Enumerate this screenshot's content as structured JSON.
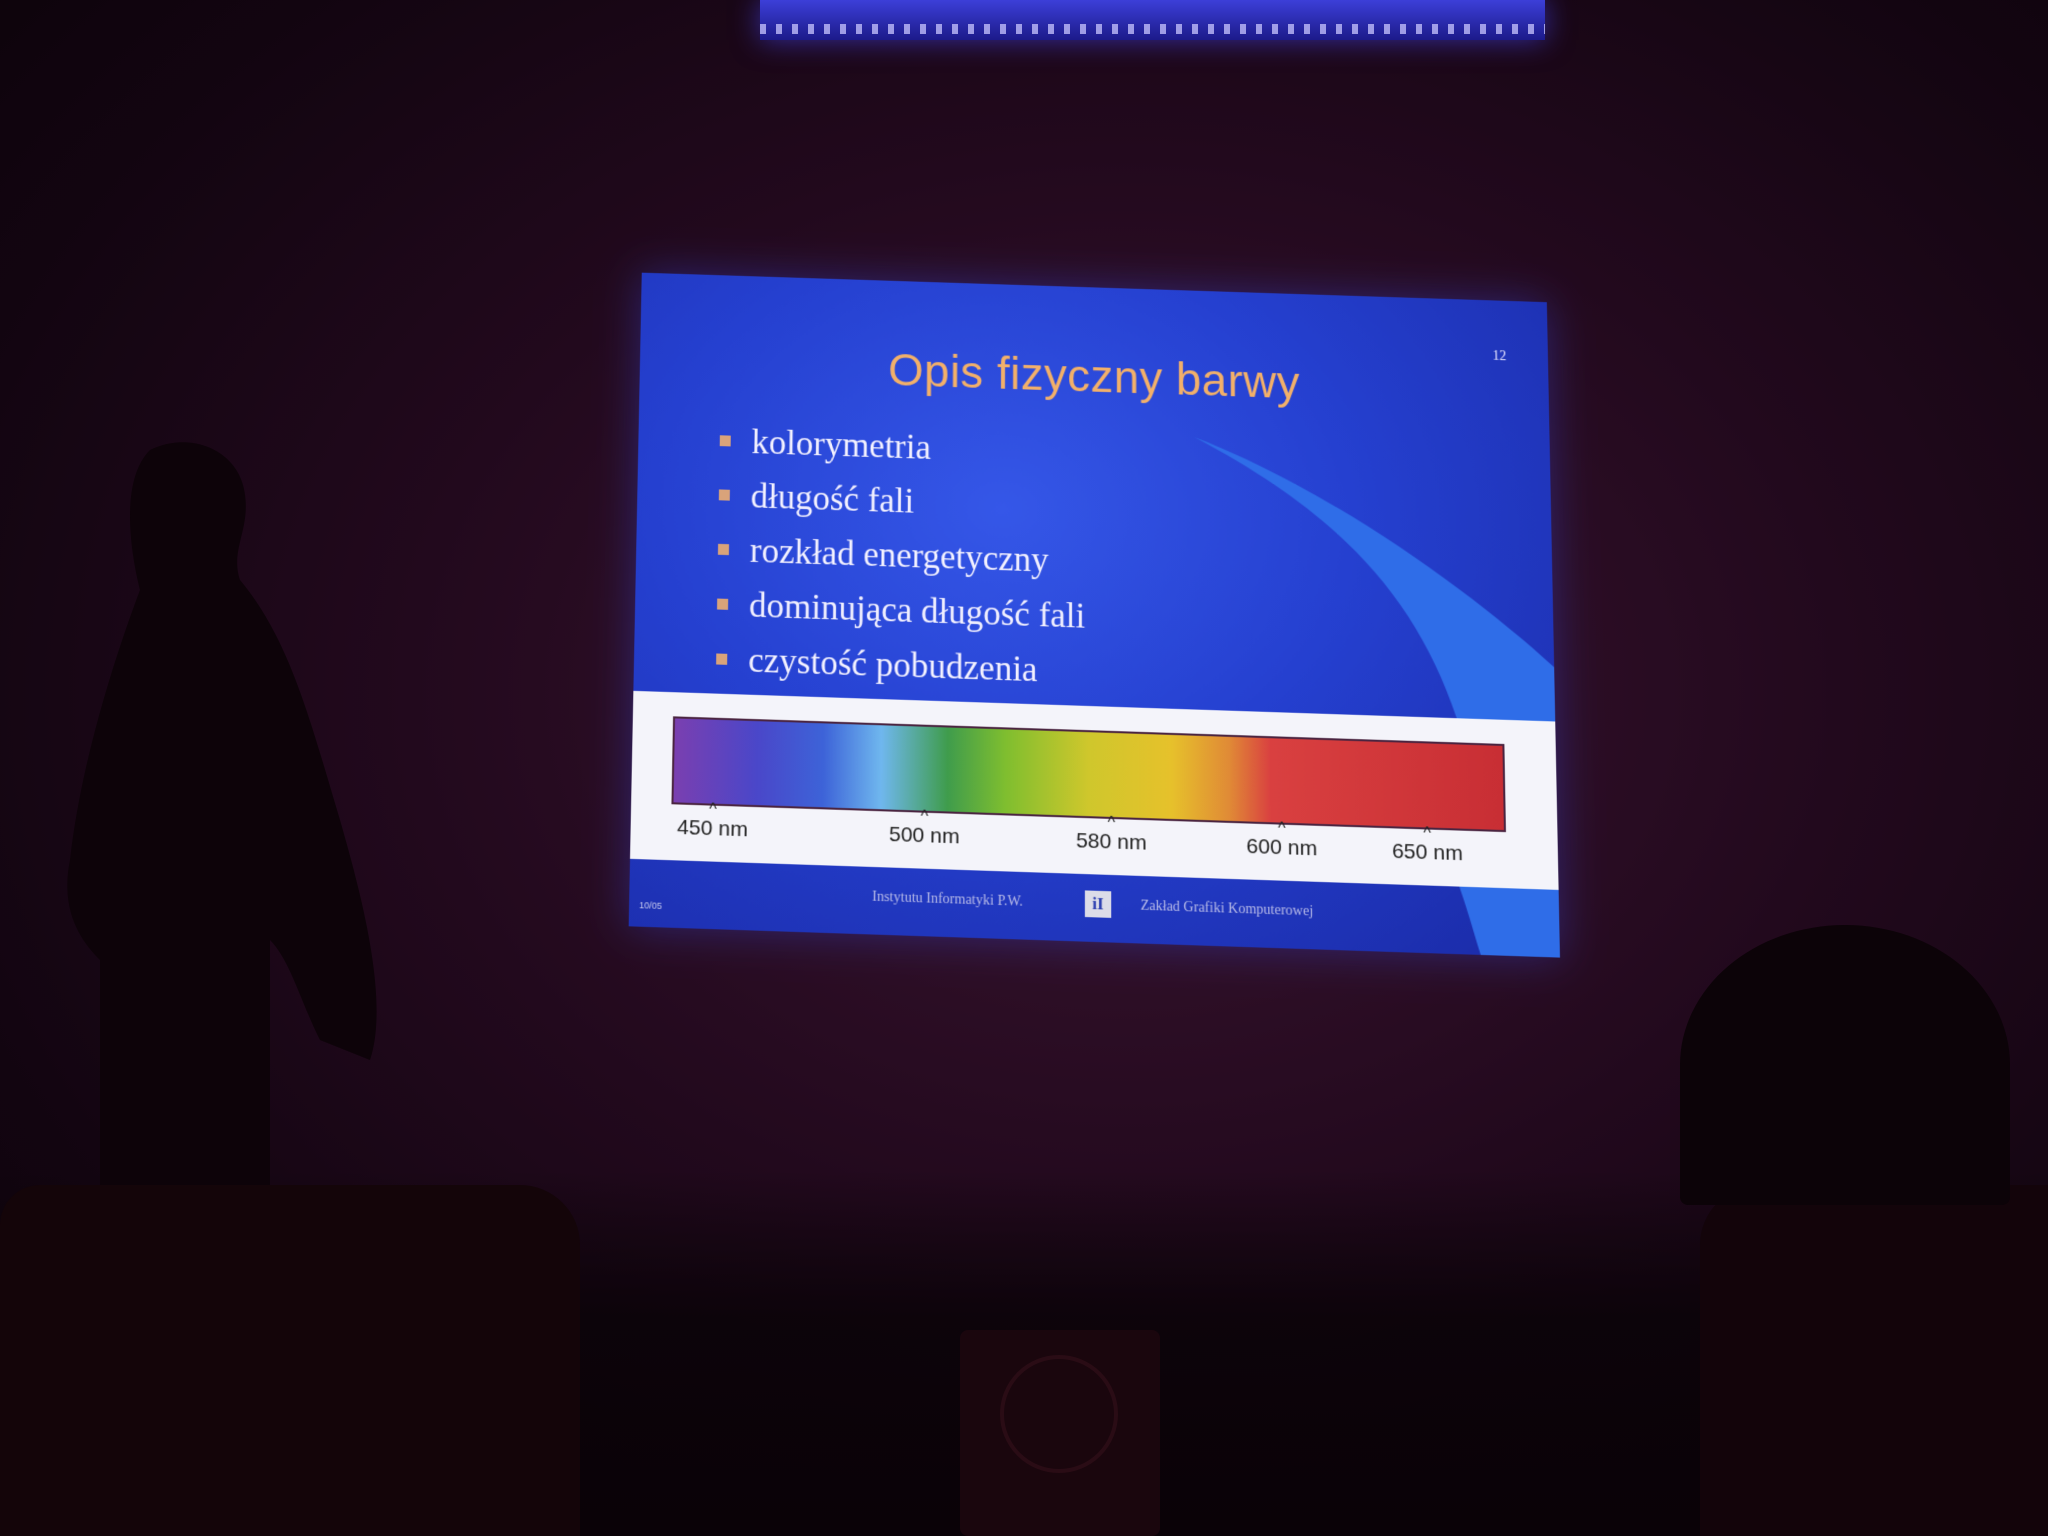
{
  "slide": {
    "number": "12",
    "title": "Opis fizyczny barwy",
    "bullets": [
      "kolorymetria",
      "długość fali",
      "rozkład energetyczny",
      "dominująca długość fali",
      "czystość pobudzenia"
    ],
    "spectrum": {
      "ticks": [
        {
          "label": "450 nm",
          "position": 0.05
        },
        {
          "label": "500 nm",
          "position": 0.305
        },
        {
          "label": "580 nm",
          "position": 0.53
        },
        {
          "label": "600 nm",
          "position": 0.735
        },
        {
          "label": "650 nm",
          "position": 0.91
        }
      ]
    },
    "footer": {
      "left": "Instytutu Informatyki P.W.",
      "logo": "iI",
      "right": "Zakład Grafiki Komputerowej",
      "date": "10/05"
    }
  },
  "colors": {
    "slide_background": "#2540d0",
    "title": "#f2b06a",
    "bullet_marker": "#d9a37a",
    "room": "#22091d"
  }
}
